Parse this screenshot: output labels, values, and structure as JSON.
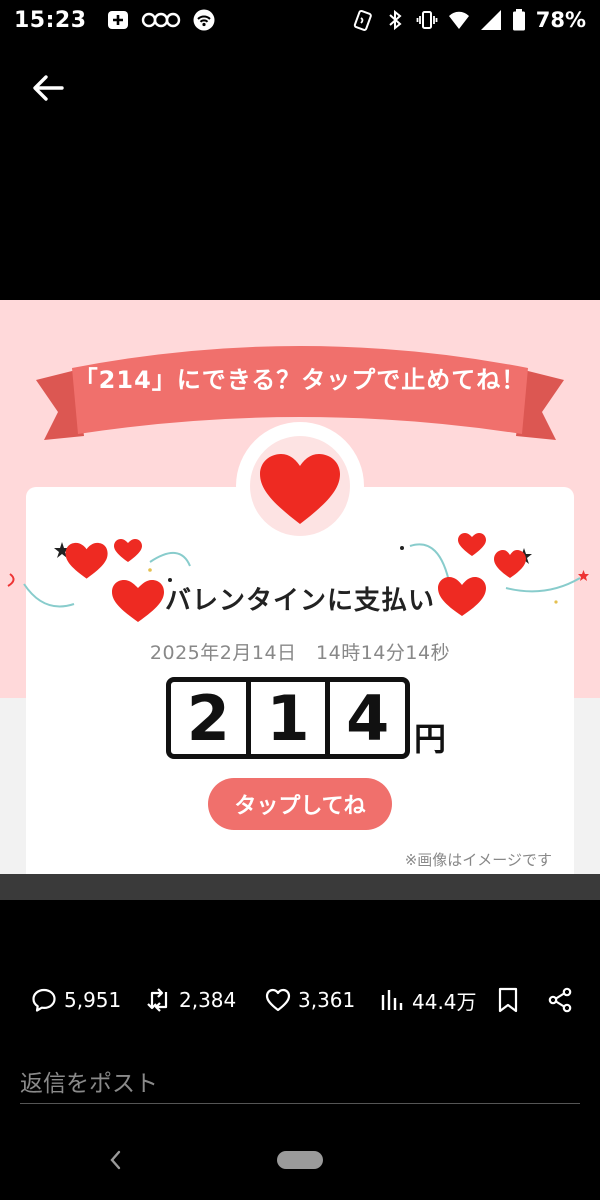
{
  "status_bar": {
    "time": "15:23",
    "battery": "78%",
    "left_icons": [
      "plus-box-icon",
      "carrier-icon",
      "wifi-icon"
    ],
    "right_icons": [
      "nfc-icon",
      "bluetooth-icon",
      "vibrate-icon",
      "wifi-signal-icon",
      "cell-signal-icon",
      "battery-icon"
    ]
  },
  "post_image": {
    "ribbon_text": "「214」にできる？タップで止めてね！",
    "title": "バレンタインに支払い",
    "date": "2025年2月14日　14時14分14秒",
    "digits": [
      "2",
      "1",
      "4"
    ],
    "currency": "円",
    "button_label": "タップしてね",
    "disclaimer": "※画像はイメージです",
    "colors": {
      "pink_band": "#ffd9da",
      "ribbon": "#f0706c",
      "heart": "#ee2a22",
      "button": "#f0706c"
    }
  },
  "actions": {
    "replies": "5,951",
    "reposts": "2,384",
    "likes": "3,361",
    "views": "44.4万"
  },
  "reply_placeholder": "返信をポスト"
}
